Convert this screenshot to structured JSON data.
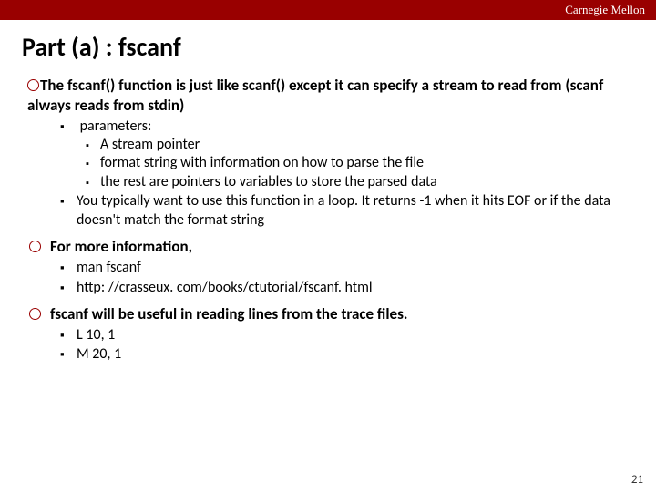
{
  "header": {
    "org": "Carnegie Mellon"
  },
  "title": "Part (a) : fscanf",
  "bullets": {
    "b1": "The fscanf() function is just like scanf() except it can specify a stream to read from (scanf always reads from stdin)",
    "b1_sub": {
      "params_label": "parameters:",
      "params": [
        "A stream pointer",
        "format string with information on how to parse the file",
        "the rest are pointers to variables to store the parsed data"
      ],
      "loop": "You typically want to use this function in a loop. It returns -1 when it hits EOF or if the data doesn't match the format string"
    },
    "b2": "For more information,",
    "b2_sub": [
      "man fscanf",
      "http: //crasseux. com/books/ctutorial/fscanf. html"
    ],
    "b3": "fscanf will be useful in reading lines from the trace files.",
    "b3_sub": [
      "L 10, 1",
      "M 20, 1"
    ]
  },
  "page_number": "21"
}
